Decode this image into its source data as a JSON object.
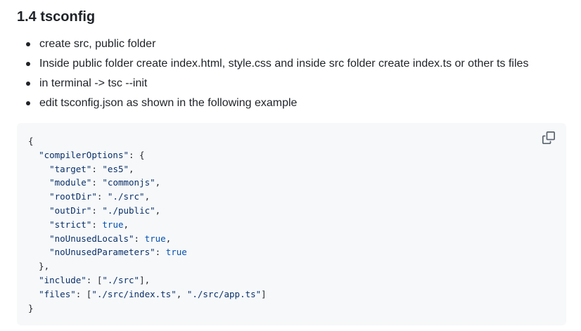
{
  "heading": "1.4 tsconfig",
  "bullets": [
    "create src, public folder",
    "Inside public folder create index.html, style.css and inside src folder create index.ts or other ts files",
    "in terminal -> tsc --init",
    "edit tsconfig.json as shown in the following example"
  ],
  "code": {
    "copy_icon": "copy-icon",
    "lines": [
      [
        {
          "t": "punc",
          "v": "{"
        }
      ],
      [
        {
          "t": "punc",
          "v": "  "
        },
        {
          "t": "key",
          "v": "\"compilerOptions\""
        },
        {
          "t": "punc",
          "v": ": {"
        }
      ],
      [
        {
          "t": "punc",
          "v": "    "
        },
        {
          "t": "key",
          "v": "\"target\""
        },
        {
          "t": "punc",
          "v": ": "
        },
        {
          "t": "str",
          "v": "\"es5\""
        },
        {
          "t": "punc",
          "v": ","
        }
      ],
      [
        {
          "t": "punc",
          "v": "    "
        },
        {
          "t": "key",
          "v": "\"module\""
        },
        {
          "t": "punc",
          "v": ": "
        },
        {
          "t": "str",
          "v": "\"commonjs\""
        },
        {
          "t": "punc",
          "v": ","
        }
      ],
      [
        {
          "t": "punc",
          "v": "    "
        },
        {
          "t": "key",
          "v": "\"rootDir\""
        },
        {
          "t": "punc",
          "v": ": "
        },
        {
          "t": "str",
          "v": "\"./src\""
        },
        {
          "t": "punc",
          "v": ","
        }
      ],
      [
        {
          "t": "punc",
          "v": "    "
        },
        {
          "t": "key",
          "v": "\"outDir\""
        },
        {
          "t": "punc",
          "v": ": "
        },
        {
          "t": "str",
          "v": "\"./public\""
        },
        {
          "t": "punc",
          "v": ","
        }
      ],
      [
        {
          "t": "punc",
          "v": "    "
        },
        {
          "t": "key",
          "v": "\"strict\""
        },
        {
          "t": "punc",
          "v": ": "
        },
        {
          "t": "bool",
          "v": "true"
        },
        {
          "t": "punc",
          "v": ","
        }
      ],
      [
        {
          "t": "punc",
          "v": "    "
        },
        {
          "t": "key",
          "v": "\"noUnusedLocals\""
        },
        {
          "t": "punc",
          "v": ": "
        },
        {
          "t": "bool",
          "v": "true"
        },
        {
          "t": "punc",
          "v": ","
        }
      ],
      [
        {
          "t": "punc",
          "v": "    "
        },
        {
          "t": "key",
          "v": "\"noUnusedParameters\""
        },
        {
          "t": "punc",
          "v": ": "
        },
        {
          "t": "bool",
          "v": "true"
        }
      ],
      [
        {
          "t": "punc",
          "v": "  },"
        }
      ],
      [
        {
          "t": "punc",
          "v": "  "
        },
        {
          "t": "key",
          "v": "\"include\""
        },
        {
          "t": "punc",
          "v": ": ["
        },
        {
          "t": "str",
          "v": "\"./src\""
        },
        {
          "t": "punc",
          "v": "],"
        }
      ],
      [
        {
          "t": "punc",
          "v": "  "
        },
        {
          "t": "key",
          "v": "\"files\""
        },
        {
          "t": "punc",
          "v": ": ["
        },
        {
          "t": "str",
          "v": "\"./src/index.ts\""
        },
        {
          "t": "punc",
          "v": ", "
        },
        {
          "t": "str",
          "v": "\"./src/app.ts\""
        },
        {
          "t": "punc",
          "v": "]"
        }
      ],
      [
        {
          "t": "punc",
          "v": "}"
        }
      ]
    ]
  },
  "colors": {
    "text": "#1f2328",
    "code_background": "#f6f8fa",
    "string": "#0a3069",
    "boolean": "#0550ae"
  }
}
